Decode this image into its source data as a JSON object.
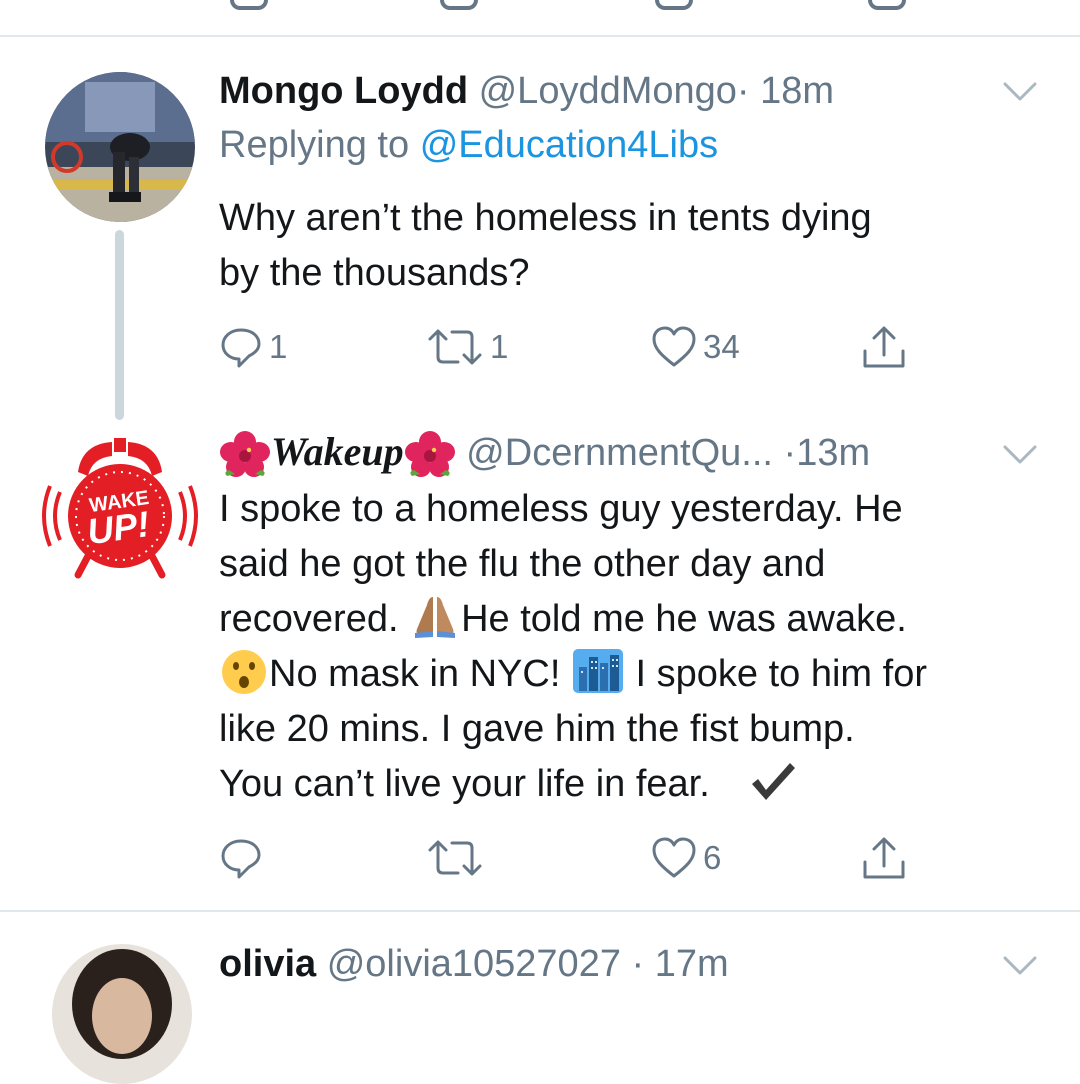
{
  "tweets": [
    {
      "display_name": "Mongo Loydd",
      "handle": "@LoyddMongo",
      "separator": "·",
      "time": "18m",
      "replying_label": "Replying to",
      "replying_handle": "@Education4Libs",
      "text_lines": [
        "Why aren’t the homeless in tents dying",
        "by the thousands?"
      ],
      "replies": "1",
      "retweets": "1",
      "likes": "34"
    },
    {
      "display_name": "Wakeup",
      "handle": "@DcernmentQu...",
      "separator": "·",
      "time": "13m",
      "avatar_text": {
        "top": "WAKE",
        "bottom": "UP!"
      },
      "text_lines": {
        "l1": "I spoke to a homeless guy yesterday. He",
        "l2": "said he got the flu the other day and",
        "l3a": "recovered.",
        "l3b": "He told me he was awake.",
        "l4a": "No mask in NYC!",
        "l4b": "I spoke to him for",
        "l5": "like 20 mins. I gave him the fist bump.",
        "l6": "You can’t live your life in fear."
      },
      "likes": "6"
    },
    {
      "display_name": "olivia",
      "handle": "@olivia10527027",
      "separator": "·",
      "time": "17m"
    }
  ],
  "icons": [
    "reply-icon",
    "retweet-icon",
    "like-icon",
    "share-icon",
    "caret-down-icon",
    "hibiscus-icon",
    "folded-hands-icon",
    "astonished-face-icon",
    "cityscape-icon",
    "check-mark-icon"
  ],
  "colors": {
    "link": "#1b95e0",
    "muted": "#657786",
    "divider": "#e1e8ed",
    "alarm_red": "#e31e24"
  }
}
